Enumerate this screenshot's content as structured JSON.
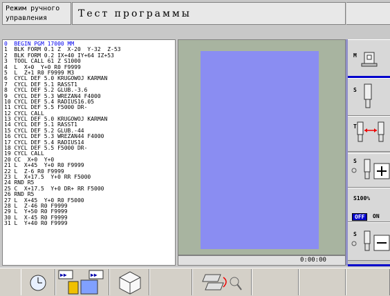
{
  "header": {
    "mode_line1": "Режим ручного",
    "mode_line2": "управления",
    "title": "Тест программы"
  },
  "program": {
    "lines": [
      "0  BEGIN PGM 17000 MM",
      "1  BLK FORM 0.1 Z  X-20  Y-32  Z-53",
      "2  BLK FORM 0.2 IX+40 IY+64 IZ+53",
      "3  TOOL CALL 61 Z S1000",
      "4  L  X+0  Y+0 R0 F9999",
      "5  L  Z+1 R0 F9999 M3",
      "6  CYCL DEF 5.0 KRUGOWOJ KARMAN",
      "7  CYCL DEF 5.1 RASST1",
      "8  CYCL DEF 5.2 GLUB.-3.6",
      "9  CYCL DEF 5.3 WREZAN4 F4000",
      "10 CYCL DEF 5.4 RADIUS16.05",
      "11 CYCL DEF 5.5 F5000 DR-",
      "12 CYCL CALL",
      "13 CYCL DEF 5.0 KRUGOWOJ KARMAN",
      "14 CYCL DEF 5.1 RASST1",
      "15 CYCL DEF 5.2 GLUB.-44",
      "16 CYCL DEF 5.3 WREZAN44 F4000",
      "17 CYCL DEF 5.4 RADIUS14",
      "18 CYCL DEF 5.5 F5000 DR-",
      "19 CYCL CALL",
      "20 CC  X+0  Y+0",
      "21 L  X+45  Y+0 R0 F9999",
      "22 L  Z-6 R0 F9999",
      "23 L  X+17.5  Y+0 RR F5000",
      "24 RND R5",
      "25 C  X+17.5  Y+0 DR+ RR F5000",
      "26 RND R5",
      "27 L  X+45  Y+0 R0 F5000",
      "28 L  Z-46 R0 F9999",
      "29 L  Y+50 R0 F9999",
      "30 L  X-45 R0 F9999",
      "31 L  Y+40 R0 F9999"
    ]
  },
  "graphics": {
    "background_color": "#a8b4a0",
    "workpiece_color": "#8a8df2",
    "timer": "0:00:00"
  },
  "side_panel": {
    "m_label": "M",
    "s_label": "S",
    "t_label": "T",
    "s_plus_label": "S",
    "override_label": "S100%",
    "off_label": "OFF",
    "on_label": "ON",
    "s_minus_label": "S"
  }
}
